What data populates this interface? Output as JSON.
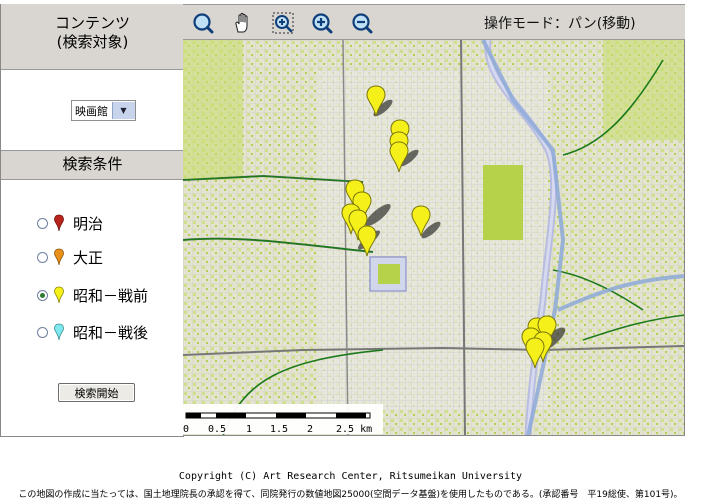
{
  "sidebar": {
    "contents_title_line1": "コンテンツ",
    "contents_title_line2": "(検索対象)",
    "content_select_value": "映画館",
    "conditions_title": "検索条件",
    "options": [
      {
        "label": "明治",
        "pin_color": "#b8241c",
        "selected": false
      },
      {
        "label": "大正",
        "pin_color": "#e8901a",
        "selected": false
      },
      {
        "label": "昭和－戦前",
        "pin_color": "#f5f01a",
        "selected": true
      },
      {
        "label": "昭和－戦後",
        "pin_color": "#7fe8ef",
        "selected": false
      }
    ],
    "search_button": "検索開始"
  },
  "toolbar": {
    "tools": [
      "search-icon",
      "hand-icon",
      "zoom-box-icon",
      "zoom-in-icon",
      "zoom-out-icon"
    ],
    "mode_text": "操作モード：パン(移動)"
  },
  "map": {
    "scale_labels": [
      "0",
      "0.5",
      "1",
      "1.5",
      "2",
      "2.5 km"
    ],
    "marker_color": "#f5f01a"
  },
  "footer": {
    "copyright": "Copyright (C) Art Research Center, Ritsumeikan University",
    "notice": "この地図の作成に当たっては、国土地理院長の承認を得て、同院発行の数値地図25000(空間データ基盤)を使用したものである。(承認番号　平19総使、第101号)。"
  }
}
